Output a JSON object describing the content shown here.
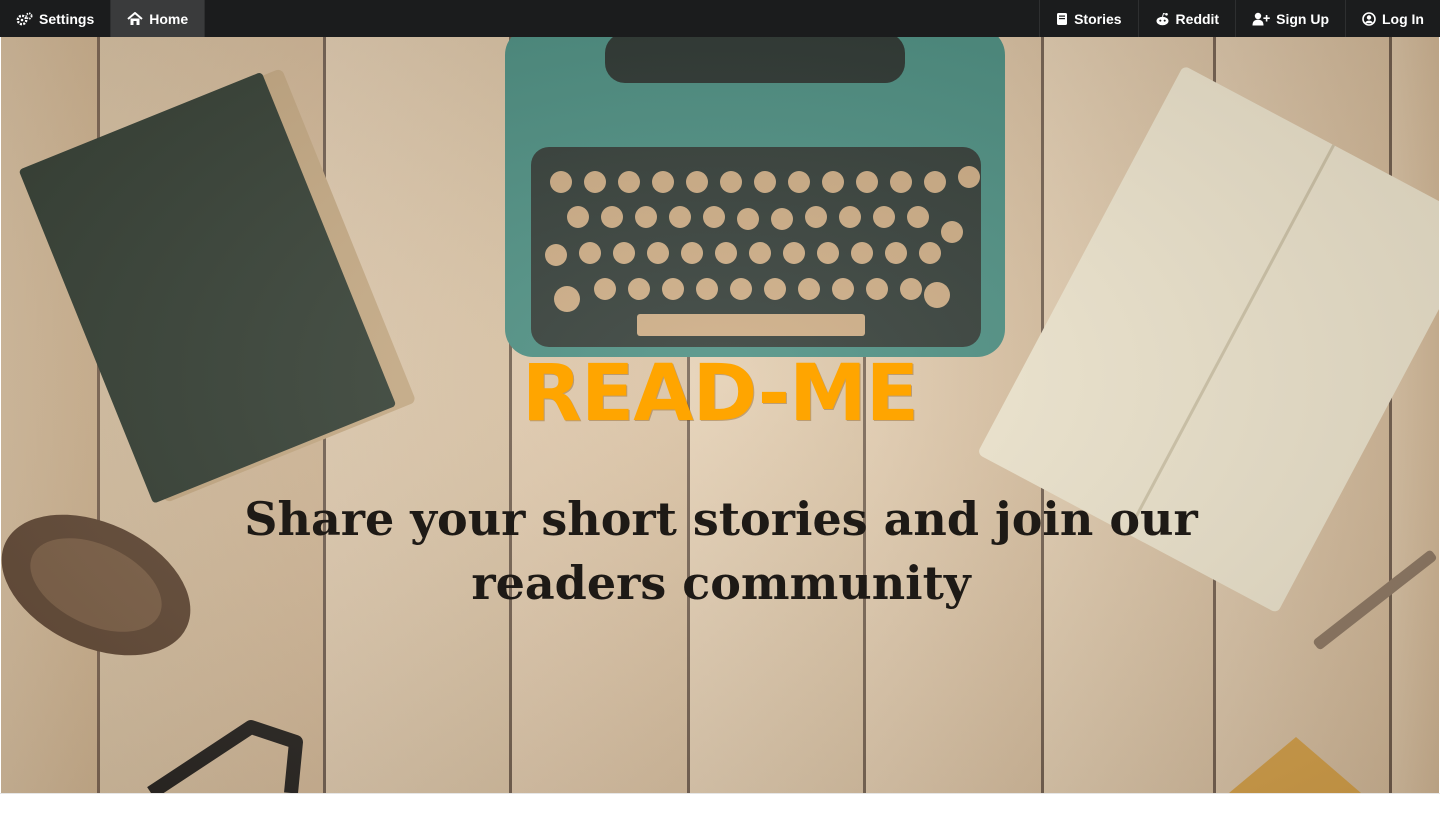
{
  "nav": {
    "left": [
      {
        "label": "Settings",
        "icon": "cogs-icon",
        "active": false
      },
      {
        "label": "Home",
        "icon": "home-icon",
        "active": true
      }
    ],
    "right": [
      {
        "label": "Stories",
        "icon": "book-icon"
      },
      {
        "label": "Reddit",
        "icon": "reddit-icon"
      },
      {
        "label": "Sign Up",
        "icon": "user-plus-icon"
      },
      {
        "label": "Log In",
        "icon": "user-circle-icon"
      }
    ]
  },
  "hero": {
    "title": "READ-ME",
    "tagline": "Share your short stories and join our readers community"
  },
  "colors": {
    "navbar": "#1b1c1d",
    "title": "#ffa500",
    "tagline": "#1e1a16"
  }
}
